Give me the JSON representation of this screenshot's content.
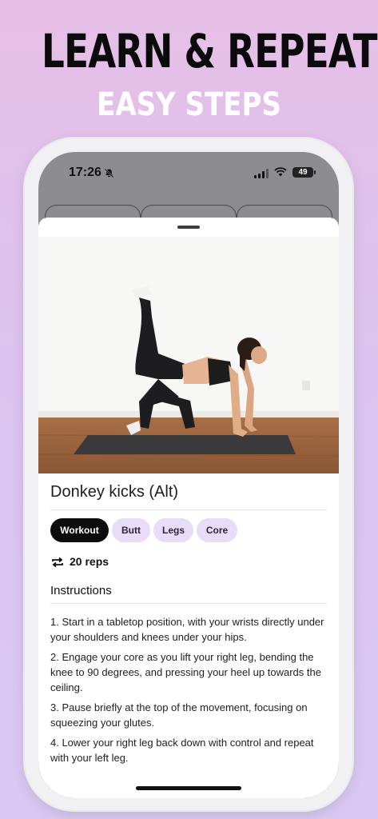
{
  "promo": {
    "headline": "LEARN & REPEAT",
    "subheadline": "EASY STEPS"
  },
  "status_bar": {
    "time": "17:26",
    "battery": "49"
  },
  "exercise": {
    "name": "Donkey kicks (Alt)",
    "tags": [
      "Workout",
      "Butt",
      "Legs",
      "Core"
    ],
    "active_tag": "Workout",
    "reps": "20 reps",
    "instructions_heading": "Instructions",
    "steps": [
      "1. Start in a tabletop position, with your wrists directly under your shoulders and knees under your hips.",
      "2. Engage your core as you lift your right leg, bending the knee to 90 degrees, and pressing your heel up towards the ceiling.",
      "3. Pause briefly at the top of the movement, focusing on squeezing your glutes.",
      "4. Lower your right leg back down with control and repeat with your left leg."
    ]
  },
  "colors": {
    "background_top": "#e6bfe6",
    "background_bottom": "#d9c9f3",
    "chip_bg": "#e8dcf8",
    "chip_active_bg": "#0c0c0c"
  },
  "icons": {
    "mute": "bell-slash-icon",
    "signal": "cellular-signal-icon",
    "wifi": "wifi-icon",
    "battery": "battery-icon",
    "reps": "repeat-icon"
  }
}
